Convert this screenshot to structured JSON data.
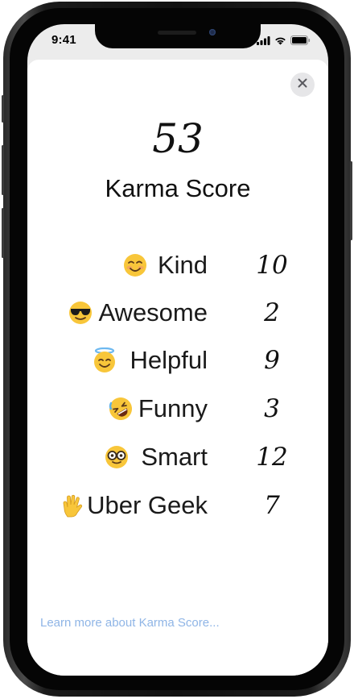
{
  "status_bar": {
    "time": "9:41"
  },
  "karma": {
    "score": "53",
    "title": "Karma Score"
  },
  "categories": [
    {
      "icon": "smiling-face-icon",
      "label": "Kind",
      "value": "10"
    },
    {
      "icon": "sunglasses-face-icon",
      "label": "Awesome",
      "value": "2"
    },
    {
      "icon": "halo-face-icon",
      "label": "Helpful",
      "value": "9"
    },
    {
      "icon": "rolling-laughing-face-icon",
      "label": "Funny",
      "value": "3"
    },
    {
      "icon": "nerd-glasses-face-icon",
      "label": "Smart",
      "value": "12"
    },
    {
      "icon": "vulcan-salute-icon",
      "label": "Uber Geek",
      "value": "7"
    }
  ],
  "footer": {
    "learn_more": "Learn more about Karma Score..."
  },
  "colors": {
    "link": "#8fb5e6",
    "emoji_yellow": "#f8c63a",
    "close_button_bg": "#e6e6e8"
  }
}
